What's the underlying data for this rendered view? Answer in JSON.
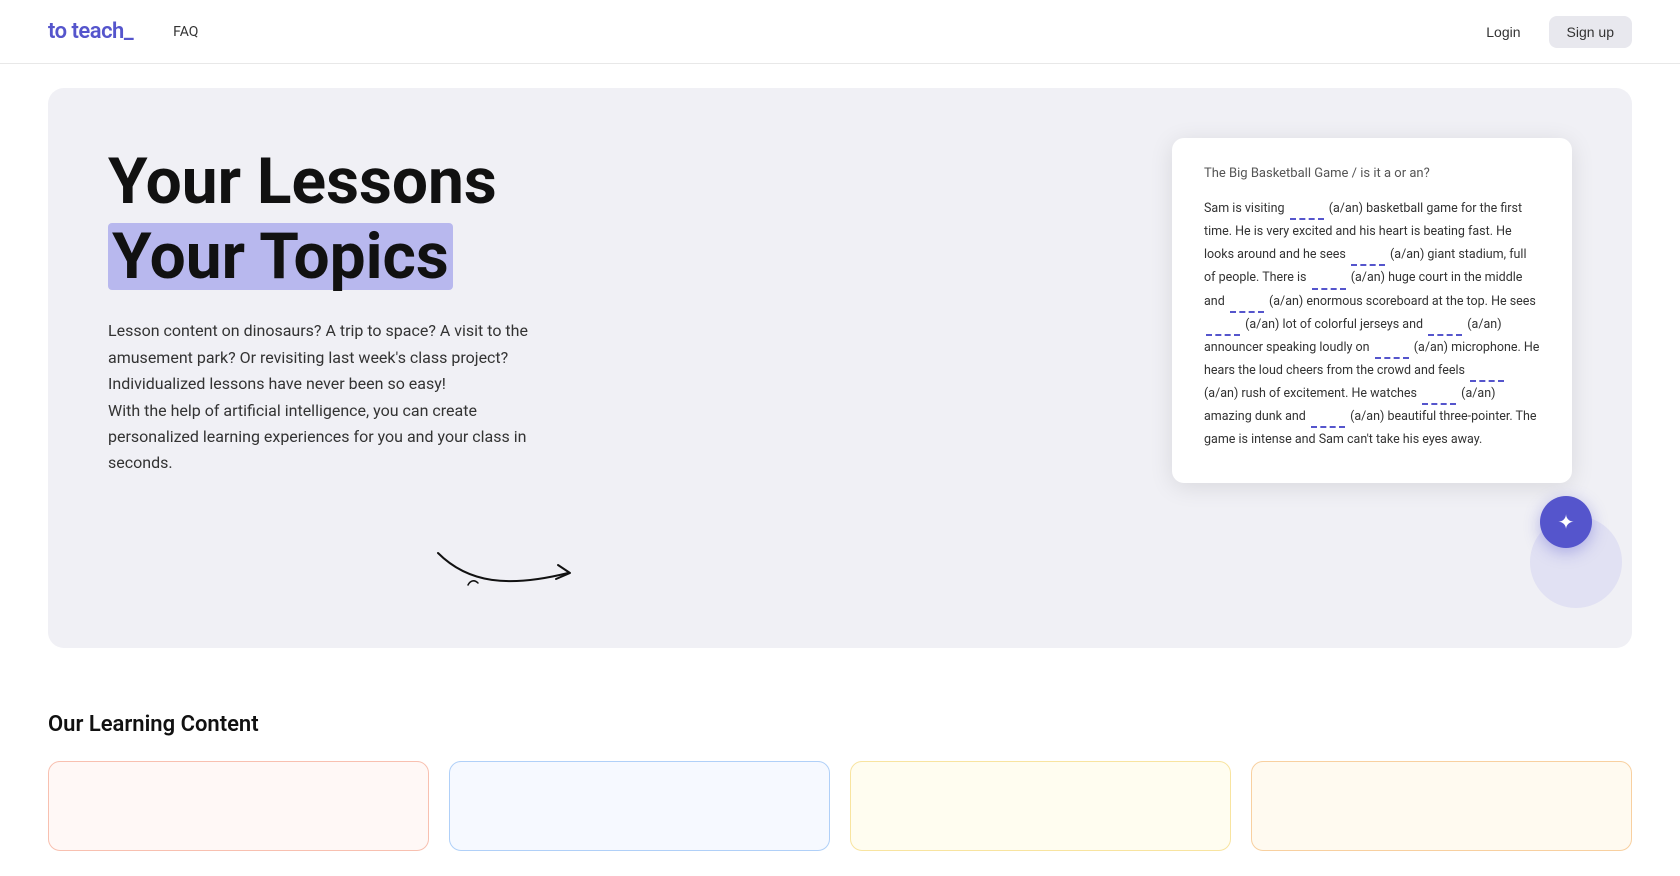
{
  "nav": {
    "logo": "to teach_",
    "faq": "FAQ",
    "login": "Login",
    "signup": "Sign up"
  },
  "hero": {
    "title_line1": "Your Lessons",
    "title_line2": "Your Topics",
    "description_lines": [
      "Lesson content on dinosaurs? A trip to space? A visit to",
      "the amusement park? Or revisiting last week's class",
      "project?",
      "Individualized lessons have never been so easy!",
      "With the help of artificial intelligence, you can create",
      "personalized learning experiences for you and your class",
      "in seconds."
    ]
  },
  "lesson_card": {
    "title": "The Big Basketball Game / is it a or an?",
    "body": "Sam is visiting  (a/an) basketball game for the first time. He is very excited and his heart is beating fast. He looks around and he sees  (a/an) giant stadium, full of people. There is  (a/an) huge court in the middle and  (a/an) enormous scoreboard at the top. He sees  (a/an) lot of colorful jerseys and  (a/an) announcer speaking loudly on  (a/an) microphone. He hears the loud cheers from the crowd and feels  (a/an) rush of excitement. He watches  (a/an) amazing dunk and  (a/an) beautiful three-pointer. The game is intense and Sam can't take his eyes away."
  },
  "learning": {
    "section_title": "Our Learning Content"
  }
}
